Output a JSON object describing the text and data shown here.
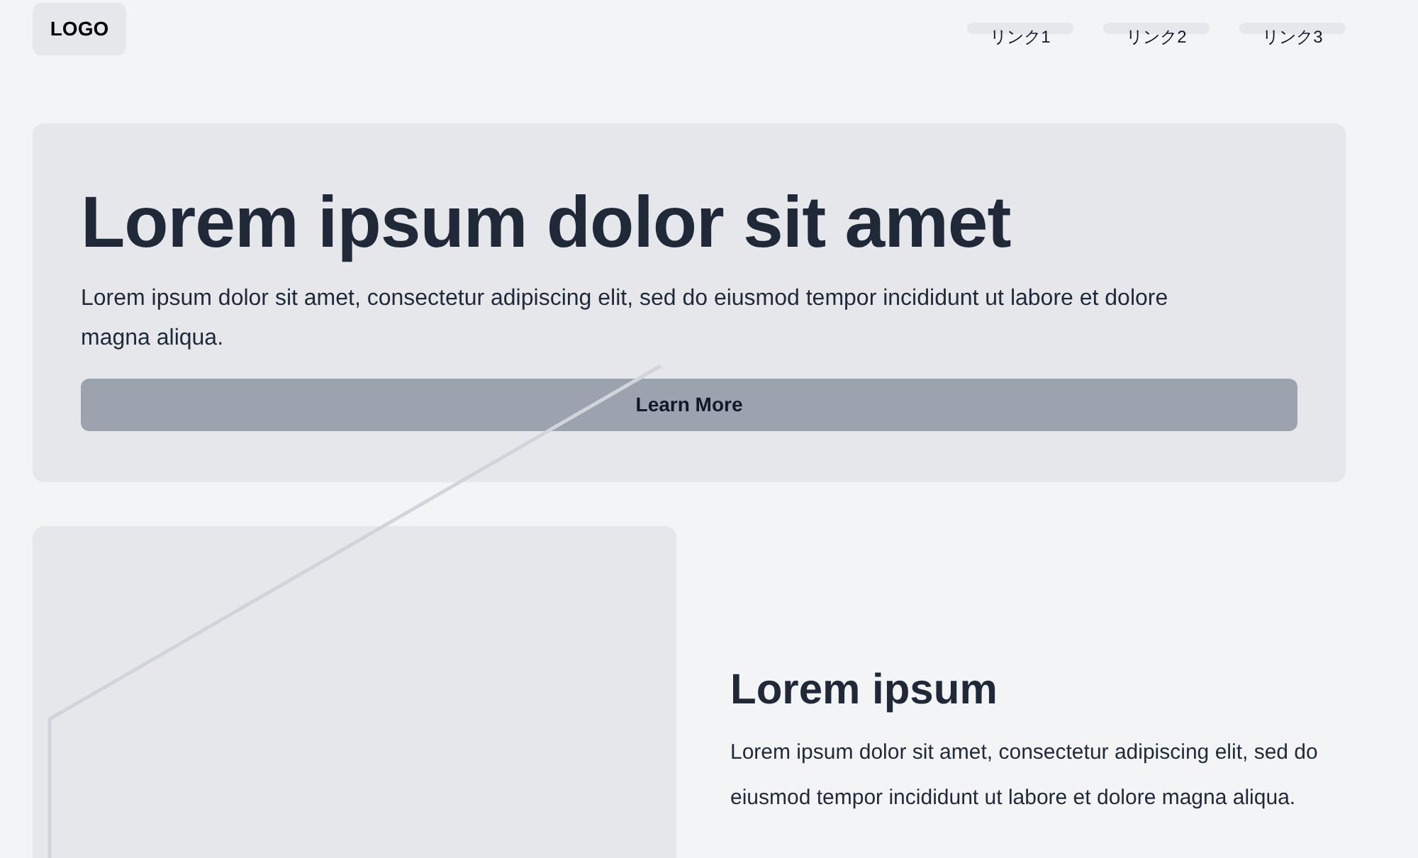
{
  "header": {
    "logo": "LOGO",
    "nav_links": [
      "リンク1",
      "リンク2",
      "リンク3"
    ]
  },
  "hero": {
    "title": "Lorem ipsum dolor sit amet",
    "text": "Lorem ipsum dolor sit amet, consectetur adipiscing elit, sed do eiusmod tempor incididunt ut labore et dolore magna aliqua.",
    "button": "Learn More"
  },
  "feature": {
    "title": "Lorem ipsum",
    "text": "Lorem ipsum dolor sit amet, consectetur adipiscing elit, sed do eiusmod tempor incididunt ut labore et dolore magna aliqua."
  }
}
